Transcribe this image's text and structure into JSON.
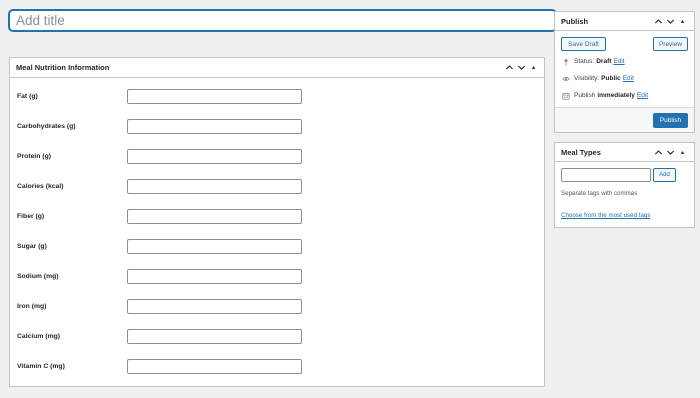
{
  "title_field": {
    "placeholder": "Add title",
    "value": ""
  },
  "nutrition_box": {
    "title": "Meal Nutrition Information",
    "fields": [
      {
        "label": "Fat (g)",
        "value": ""
      },
      {
        "label": "Carbohydrates (g)",
        "value": ""
      },
      {
        "label": "Protein (g)",
        "value": ""
      },
      {
        "label": "Calories (kcal)",
        "value": ""
      },
      {
        "label": "Fiber (g)",
        "value": ""
      },
      {
        "label": "Sugar (g)",
        "value": ""
      },
      {
        "label": "Sodium (mg)",
        "value": ""
      },
      {
        "label": "Iron (mg)",
        "value": ""
      },
      {
        "label": "Calcium (mg)",
        "value": ""
      },
      {
        "label": "Vitamin C (mg)",
        "value": ""
      }
    ]
  },
  "publish_box": {
    "title": "Publish",
    "save_draft_label": "Save Draft",
    "preview_label": "Preview",
    "status": {
      "prefix": "Status:",
      "value": "Draft",
      "edit": "Edit"
    },
    "visibility": {
      "prefix": "Visibility:",
      "value": "Public",
      "edit": "Edit"
    },
    "schedule": {
      "prefix": "Publish",
      "value": "immediately",
      "edit": "Edit"
    },
    "publish_label": "Publish"
  },
  "meal_types_box": {
    "title": "Meal Types",
    "tag_input_value": "",
    "add_label": "Add",
    "hint": "Separate tags with commas",
    "most_used_link": "Choose from the most used tags"
  },
  "icons": {
    "collapse_up": "chevron-up-icon",
    "collapse_down": "chevron-down-icon",
    "toggle": "triangle-toggle-icon",
    "status": "pin-icon",
    "visibility": "eye-icon",
    "schedule": "calendar-icon"
  },
  "colors": {
    "accent": "#2271b1",
    "background": "#f0f0f1",
    "border": "#c3c4c7",
    "text": "#1d2327"
  }
}
